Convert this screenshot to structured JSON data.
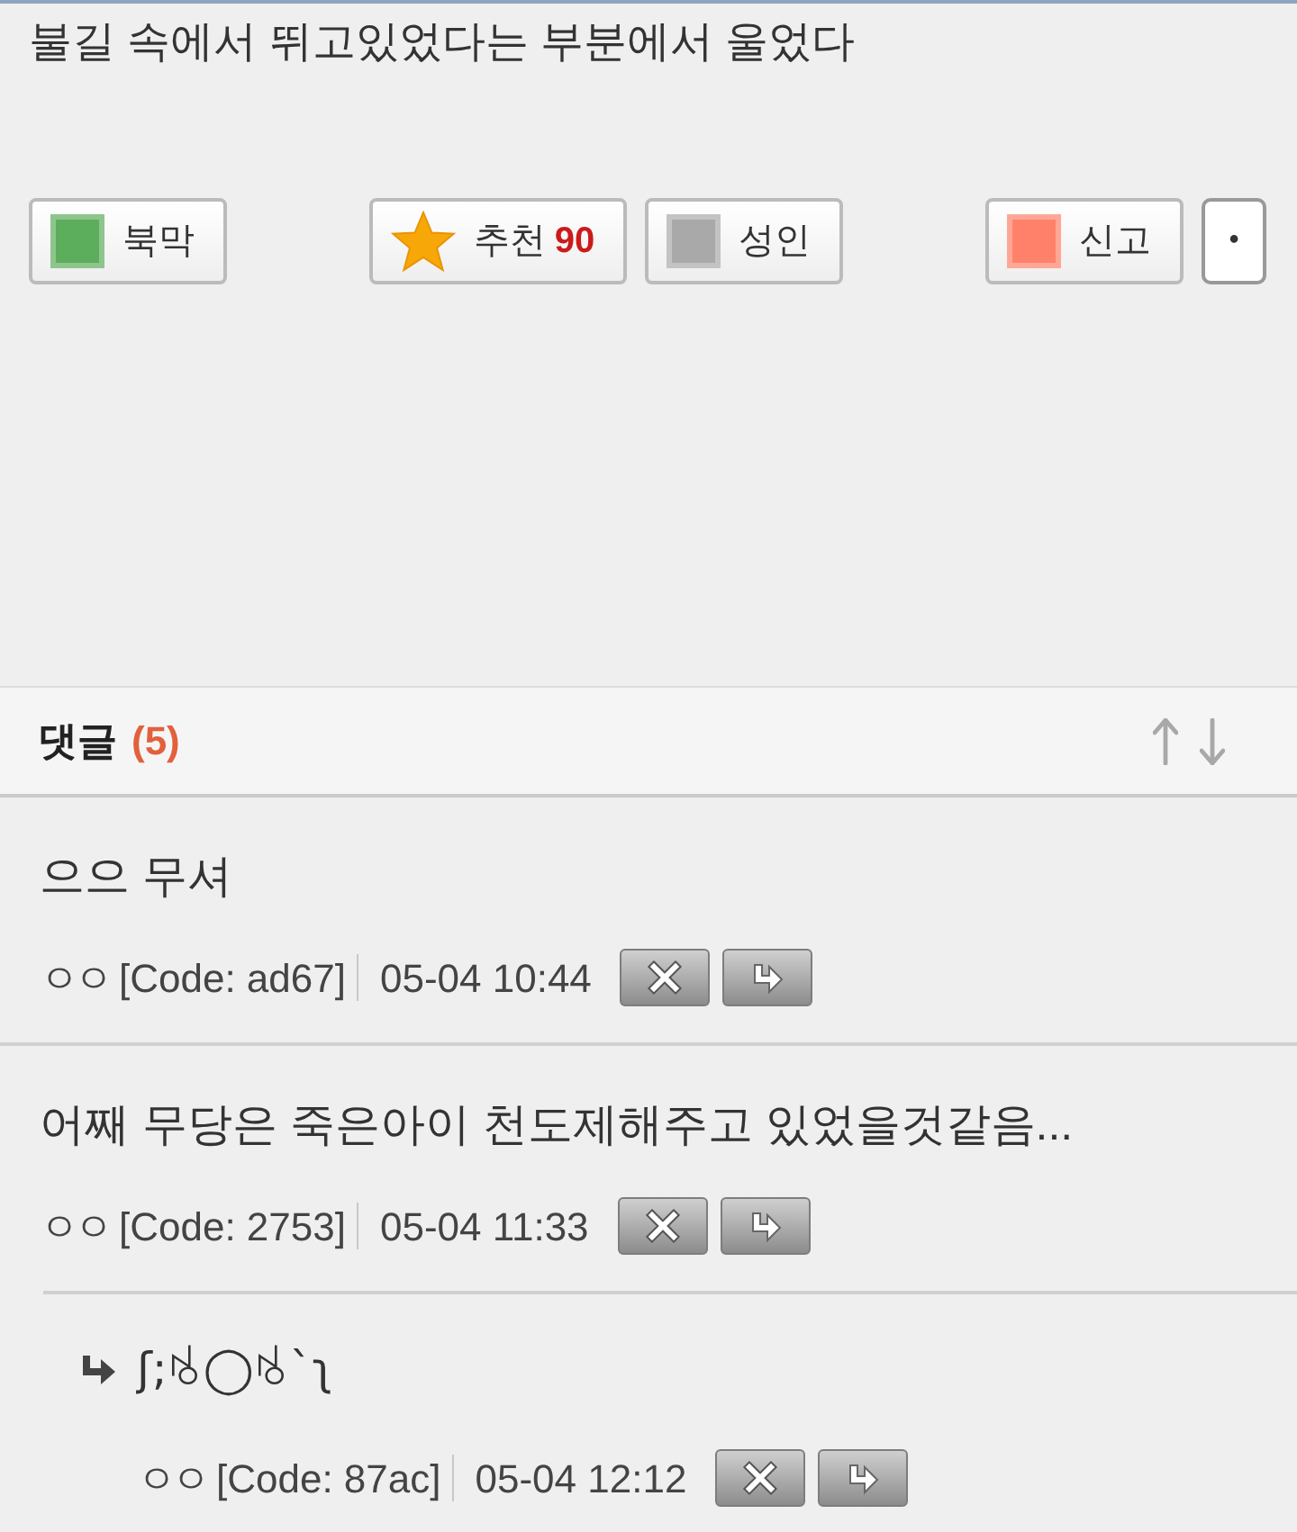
{
  "post": {
    "text": "불길 속에서 뛰고있었다는 부분에서 울었다"
  },
  "action_groups": [
    [
      {
        "kind": "swatch",
        "label": "북막",
        "color": "#5cad5c"
      }
    ],
    [
      {
        "kind": "star",
        "label": "추천",
        "count": "90"
      },
      {
        "kind": "swatch",
        "label": "성인",
        "color": "#a9a9a9"
      }
    ],
    [
      {
        "kind": "swatch",
        "label": "신고",
        "color": "#ff8169"
      },
      {
        "kind": "plain",
        "label": "•"
      }
    ]
  ],
  "comments": {
    "title": "댓글",
    "count": "(5)",
    "items": [
      {
        "text": "으으 무셔",
        "author": "ㅇㅇ",
        "code": "[Code: ad67]",
        "time": "05-04 10:44"
      },
      {
        "text": "어째 무당은 죽은아이 천도제해주고 있었을것같음...",
        "author": "ㅇㅇ",
        "code": "[Code: 2753]",
        "time": "05-04 11:33",
        "children": [
          {
            "text": "ʃ;ꂚ◯ꂚ`ʅ",
            "author": "ㅇㅇ",
            "code": "[Code: 87ac]",
            "time": "05-04 12:12"
          }
        ]
      }
    ]
  }
}
